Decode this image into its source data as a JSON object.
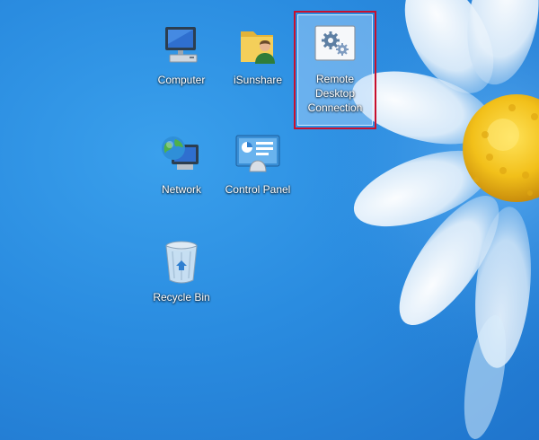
{
  "desktop": {
    "icons": [
      {
        "id": "computer",
        "label": "Computer",
        "icon": "computer-icon"
      },
      {
        "id": "isunshare",
        "label": "iSunshare",
        "icon": "user-folder-icon"
      },
      {
        "id": "remote-desktop",
        "label": "Remote Desktop Connection",
        "icon": "remote-desktop-gear-icon",
        "selected": true
      },
      {
        "id": "network",
        "label": "Network",
        "icon": "network-globe-icon"
      },
      {
        "id": "control-panel",
        "label": "Control Panel",
        "icon": "control-panel-icon"
      },
      {
        "id": "recycle-bin",
        "label": "Recycle Bin",
        "icon": "recycle-bin-icon"
      }
    ]
  },
  "colors": {
    "background": "#2a88dc",
    "highlight_border": "#c8102e",
    "flower_center": "#f2c81a",
    "petal": "#ffffff"
  }
}
